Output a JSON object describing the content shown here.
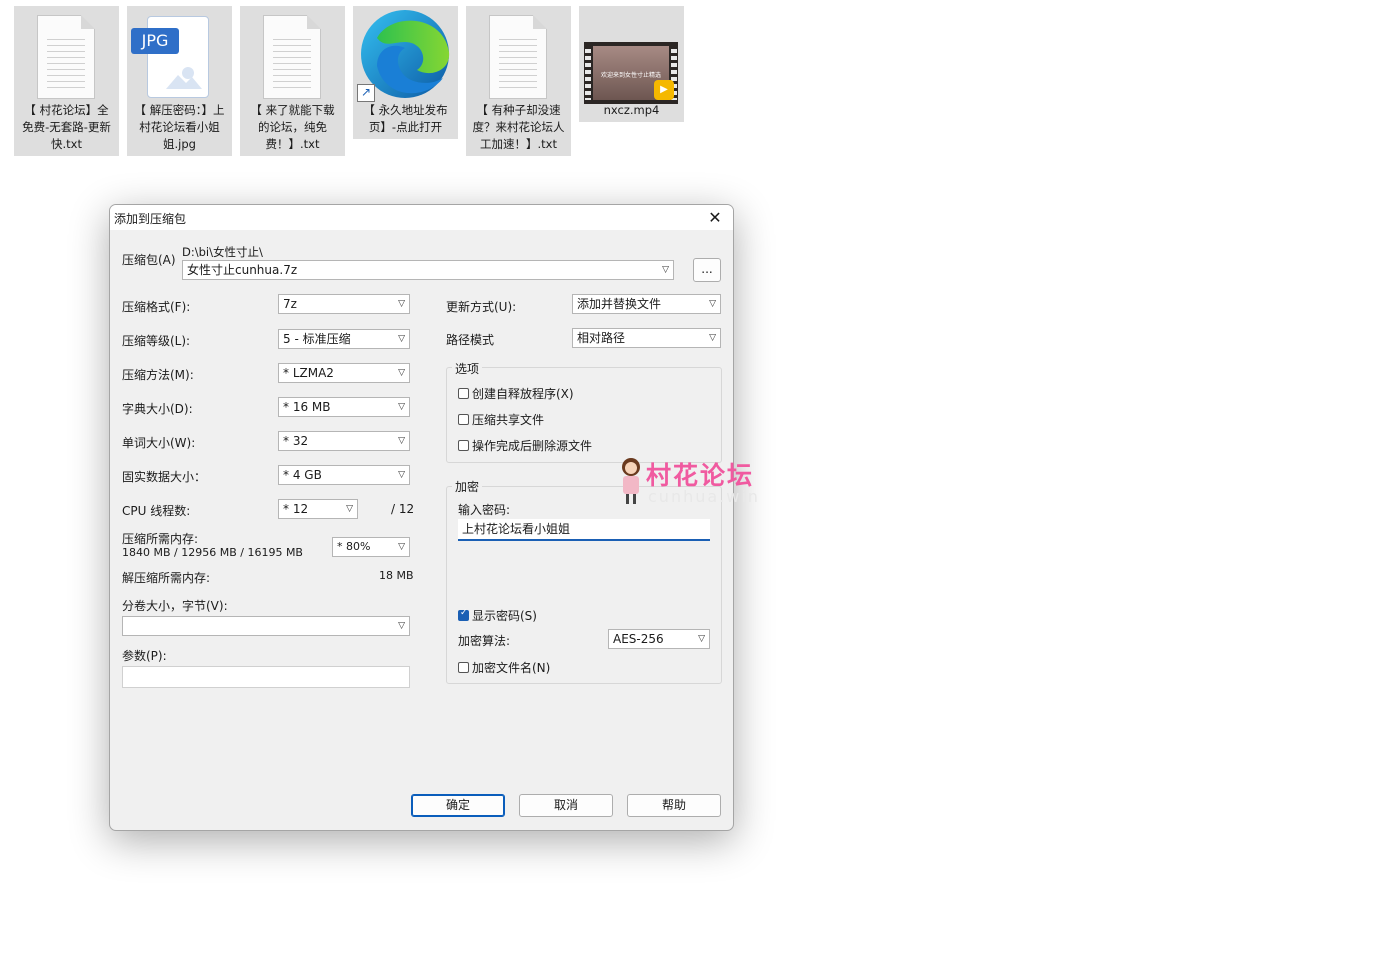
{
  "desktop_files": [
    {
      "label": "【 村花论坛】全免费-无套路-更新快.txt",
      "icon": "text-file-icon"
    },
    {
      "label": "【 解压密码：】上村花论坛看小姐姐.jpg",
      "icon": "jpg-file-icon",
      "badge": "JPG"
    },
    {
      "label": "【 来了就能下载的论坛，纯免费！】.txt",
      "icon": "text-file-icon"
    },
    {
      "label": "【 永久地址发布页】-点此打开",
      "icon": "edge-shortcut-icon"
    },
    {
      "label": "【 有种子却没速度？来村花论坛人工加速！】.txt",
      "icon": "text-file-icon"
    },
    {
      "label": "nxcz.mp4",
      "icon": "video-thumbnail-icon",
      "thumb_text": "欢迎来到女性寸止精选",
      "badge": "Player"
    }
  ],
  "dialog": {
    "title": "添加到压缩包",
    "archive": {
      "label": "压缩包(A)",
      "path": "D:\\bi\\女性寸止\\",
      "value": "女性寸止cunhua.7z",
      "browse_label": "..."
    },
    "left": {
      "format": {
        "label": "压缩格式(F):",
        "value": "7z"
      },
      "level": {
        "label": "压缩等级(L):",
        "value": "5 - 标准压缩"
      },
      "method": {
        "label": "压缩方法(M):",
        "value": "* LZMA2"
      },
      "dict": {
        "label": "字典大小(D):",
        "value": "* 16 MB"
      },
      "word": {
        "label": "单词大小(W):",
        "value": "* 32"
      },
      "solid": {
        "label": "固实数据大小：",
        "value": "* 4 GB"
      },
      "threads": {
        "label": "CPU 线程数:",
        "value": "* 12",
        "max": "/ 12"
      },
      "mem_compress": {
        "label": "压缩所需内存:",
        "detail": "1840 MB / 12956 MB / 16195 MB",
        "value": "* 80%"
      },
      "mem_decompress": {
        "label": "解压缩所需内存:",
        "value": "18 MB"
      },
      "split": {
        "label": "分卷大小，字节(V):",
        "value": ""
      },
      "params": {
        "label": "参数(P):",
        "value": ""
      }
    },
    "right": {
      "update": {
        "label": "更新方式(U):",
        "value": "添加并替换文件"
      },
      "pathmode": {
        "label": "路径模式",
        "value": "相对路径"
      },
      "options": {
        "title": "选项",
        "sfx": {
          "label": "创建自释放程序(X)",
          "checked": false
        },
        "shared": {
          "label": "压缩共享文件",
          "checked": false
        },
        "delete": {
          "label": "操作完成后删除源文件",
          "checked": false
        }
      },
      "encryption": {
        "title": "加密",
        "password_label": "输入密码:",
        "password_value": "上村花论坛看小姐姐",
        "show_password": {
          "label": "显示密码(S)",
          "checked": true
        },
        "method_label": "加密算法:",
        "method_value": "AES-256",
        "encrypt_names": {
          "label": "加密文件名(N)",
          "checked": false
        }
      }
    },
    "buttons": {
      "ok": "确定",
      "cancel": "取消",
      "help": "帮助"
    }
  },
  "watermark": {
    "title": "村花论坛",
    "subtitle": "cunhua.win"
  }
}
